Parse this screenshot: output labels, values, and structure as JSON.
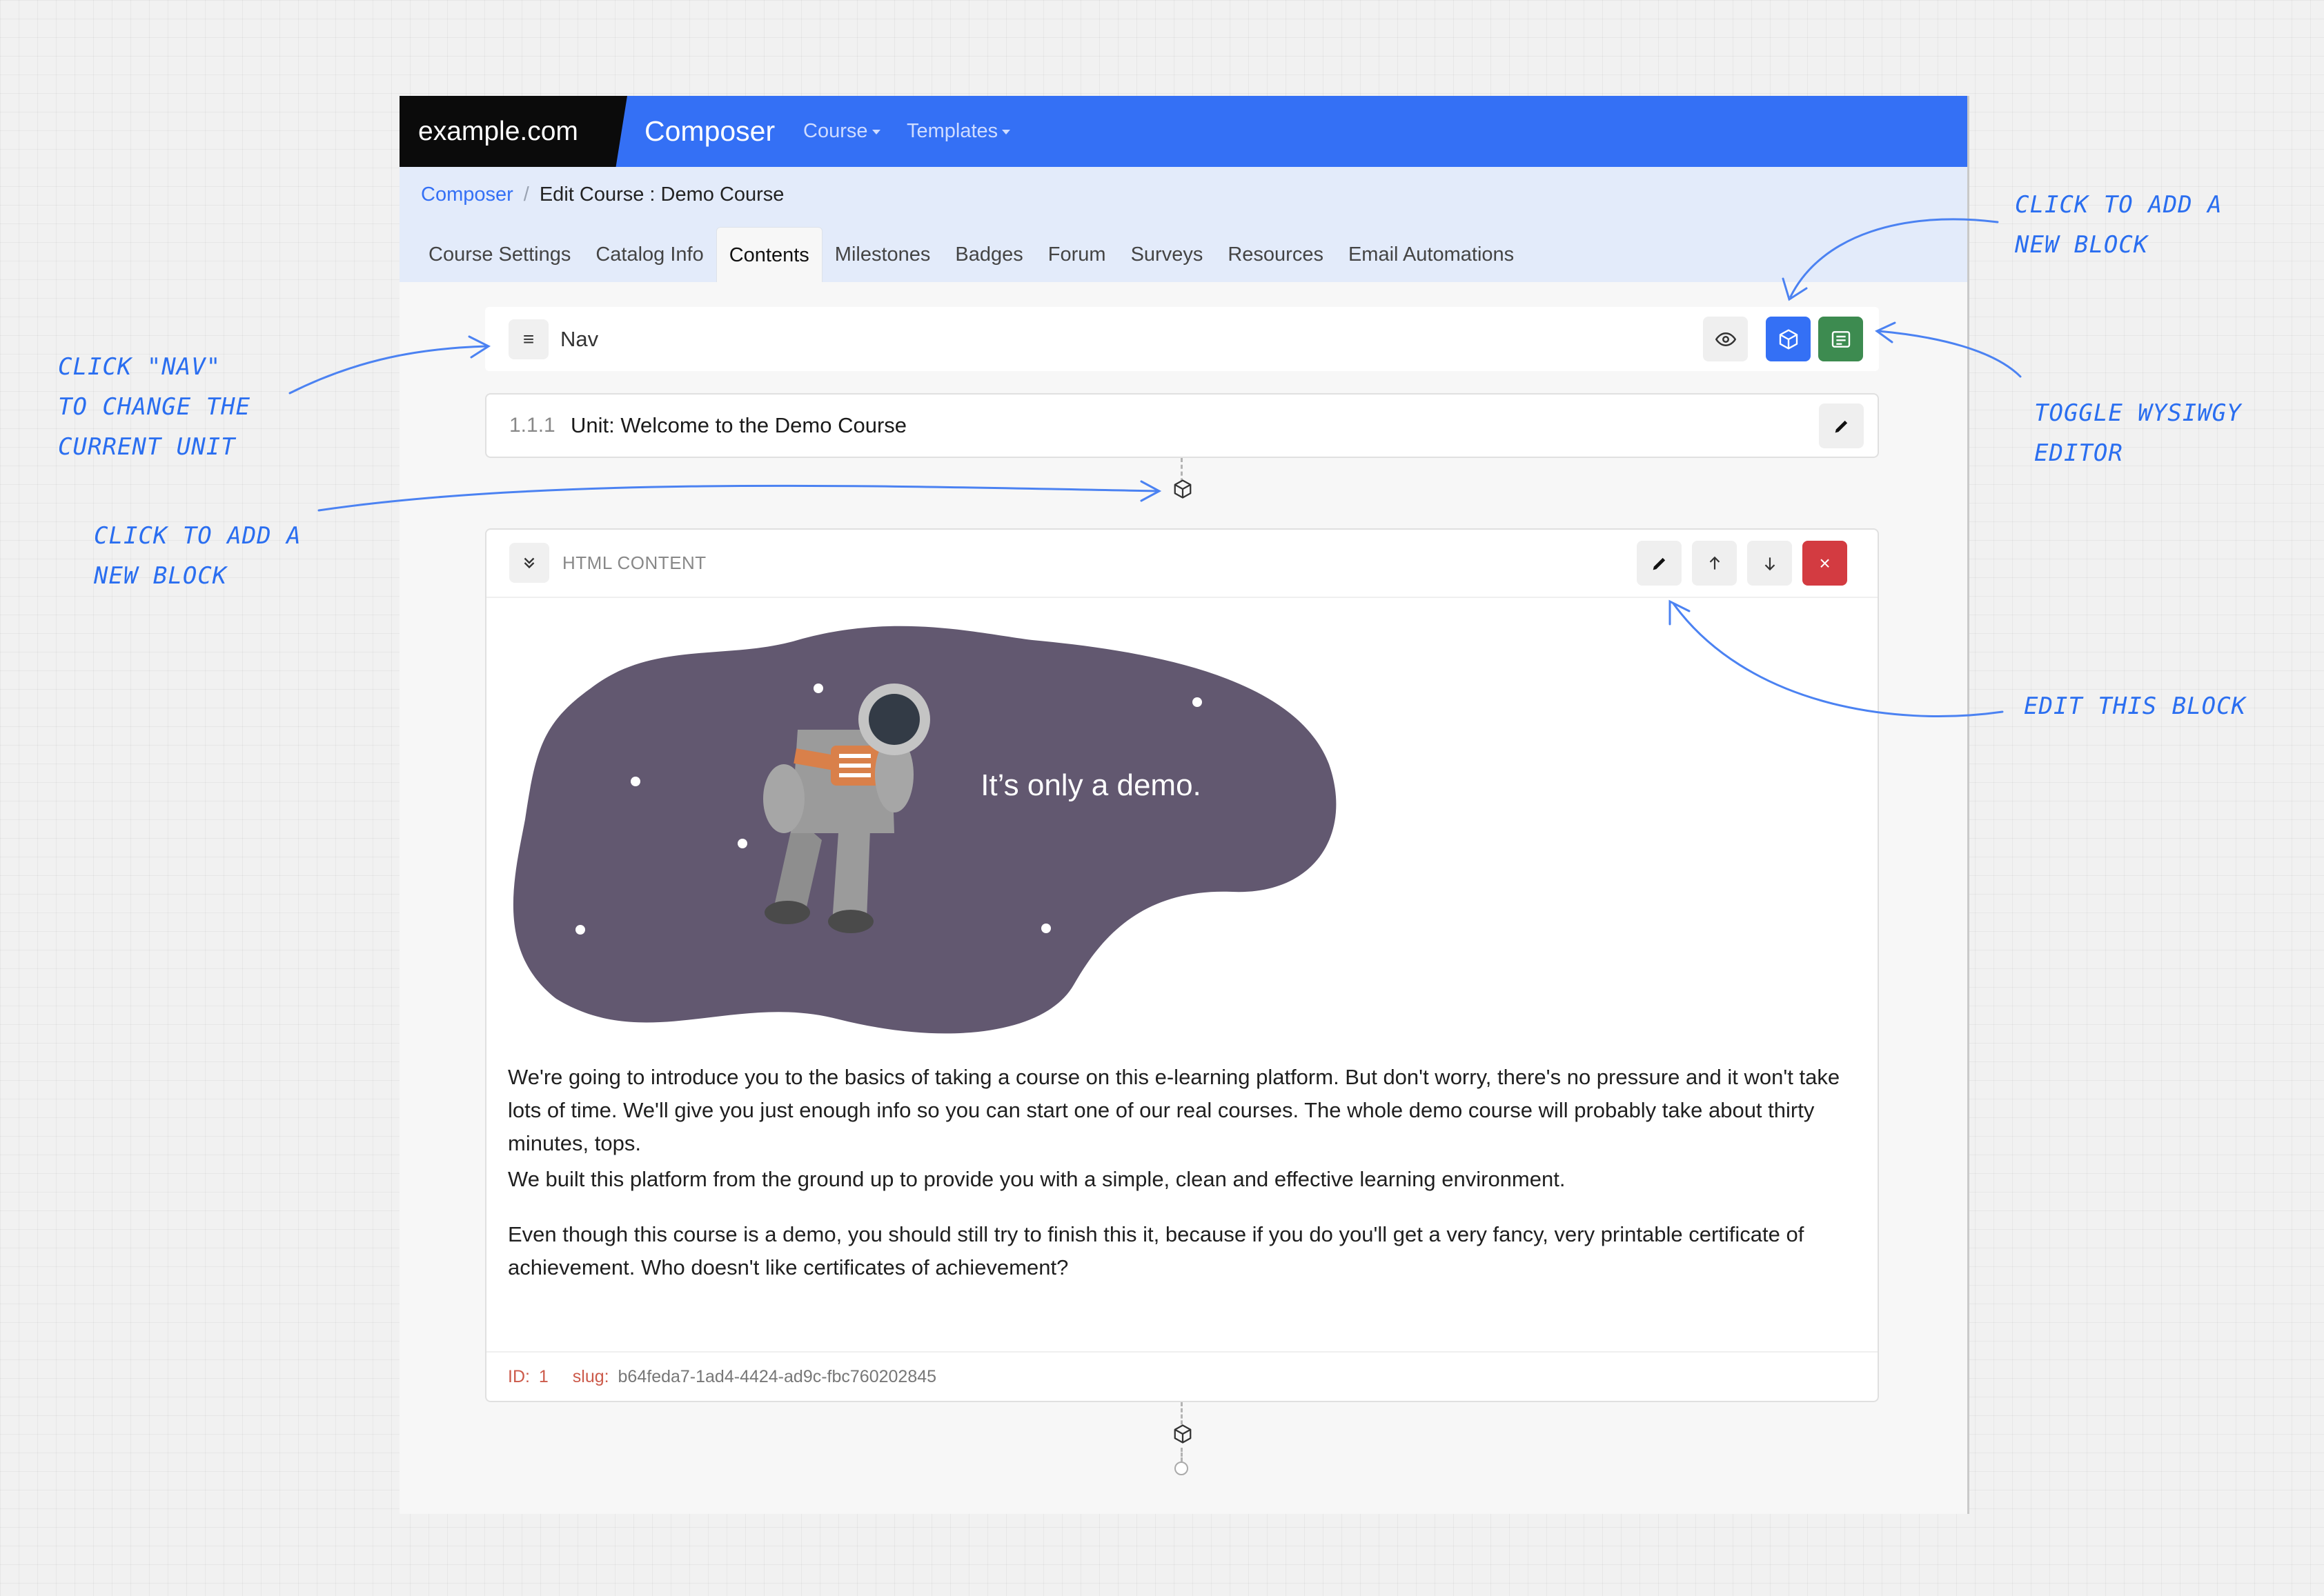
{
  "topbar": {
    "brand": "example.com",
    "app_title": "Composer",
    "menus": [
      {
        "label": "Course"
      },
      {
        "label": "Templates"
      }
    ]
  },
  "breadcrumb": {
    "root": "Composer",
    "separator": "/",
    "current": "Edit Course : Demo Course"
  },
  "tabs": [
    "Course Settings",
    "Catalog Info",
    "Contents",
    "Milestones",
    "Badges",
    "Forum",
    "Surveys",
    "Resources",
    "Email Automations"
  ],
  "active_tab": "Contents",
  "nav_bar": {
    "hamburger": "≡",
    "label": "Nav"
  },
  "unit": {
    "number": "1.1.1",
    "title": "Unit: Welcome to the Demo Course"
  },
  "block": {
    "type": "HTML CONTENT",
    "delete_glyph": "×",
    "illustration_caption": "It’s only a demo.",
    "paragraphs": [
      "We're going to introduce you to the basics of taking a course on this e-learning platform. But don't worry, there's no pressure and it won't take lots of time. We'll give you just enough info so you can start one of our real courses. The whole demo course will probably take about thirty minutes, tops.",
      "We built this platform from the ground up to provide you with a simple, clean and effective learning environment.",
      "Even though this course is a demo, you should still try to finish this it, because if you do you'll get a very fancy, very printable certificate of achievement. Who doesn't like certificates of achievement?"
    ],
    "id_label": "ID:",
    "id_value": "1",
    "slug_label": "slug:",
    "slug_value": "b64feda7-1ad4-4424-ad9c-fbc760202845"
  },
  "annotations": {
    "nav": "Click \"Nav\"\nto change the\ncurrent unit",
    "add_block_left": "Click to add a\nnew block",
    "add_block_right": "Click to add a\nnew block",
    "toggle_wysiwyg": "Toggle WYSIWGY\nEditor",
    "edit_block": "Edit this block"
  },
  "colors": {
    "primary": "#3470f5",
    "green": "#3d8b50",
    "danger": "#d33b41",
    "annotation": "#2a6ef0",
    "illustration_bg": "#625870"
  }
}
